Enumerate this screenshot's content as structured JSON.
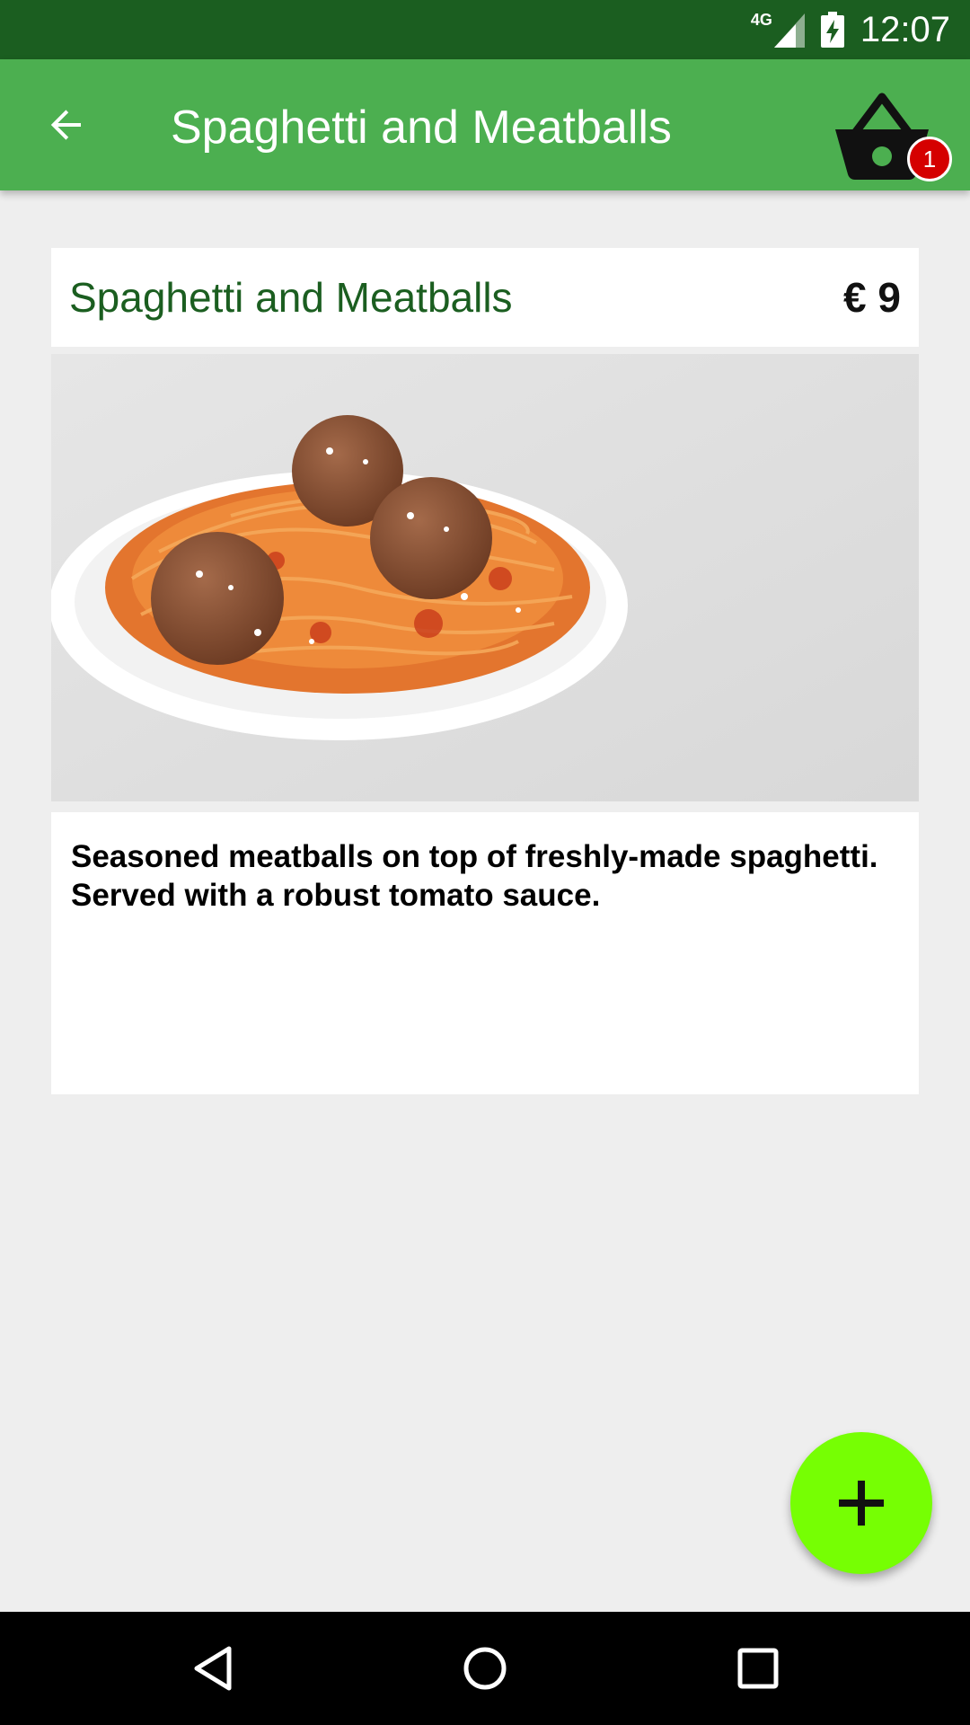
{
  "status_bar": {
    "network": "4G",
    "time": "12:07",
    "icons": [
      "signal-icon",
      "battery-charging-icon"
    ]
  },
  "app_bar": {
    "title": "Spaghetti and Meatballs",
    "back_icon": "arrow-back-icon",
    "cart_icon": "basket-icon",
    "cart_count": "1",
    "colors": {
      "background": "#4caf50",
      "status": "#1b5e20",
      "badge": "#d50000"
    }
  },
  "product": {
    "name": "Spaghetti and Meatballs",
    "price": "€ 9",
    "image_icon": "spaghetti-meatballs-photo",
    "description": "Seasoned meatballs on top of freshly-made spaghetti. Served with a robust tomato sauce."
  },
  "fab": {
    "icon": "plus-icon",
    "color": "#76ff03"
  },
  "nav_bar": {
    "icons": [
      "back-triangle-icon",
      "home-circle-icon",
      "recents-square-icon"
    ]
  }
}
